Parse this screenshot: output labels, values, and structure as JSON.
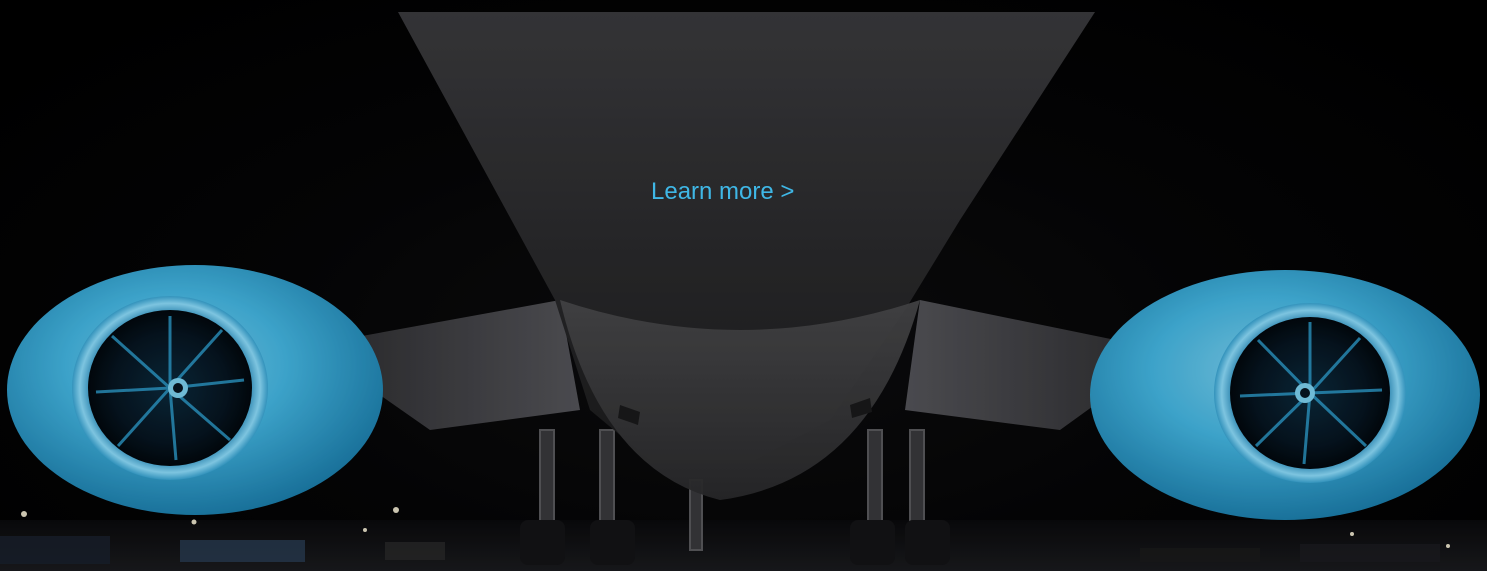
{
  "hero": {
    "cta_label": "Learn more >",
    "cta_color": "#3fb7e6",
    "image_subject": "aircraft-underside-with-engines"
  },
  "palette": {
    "engine_blue": "#45b9e5",
    "engine_deep": "#1779a8",
    "fuselage_grey": "#2b2b2d",
    "background": "#000000"
  }
}
